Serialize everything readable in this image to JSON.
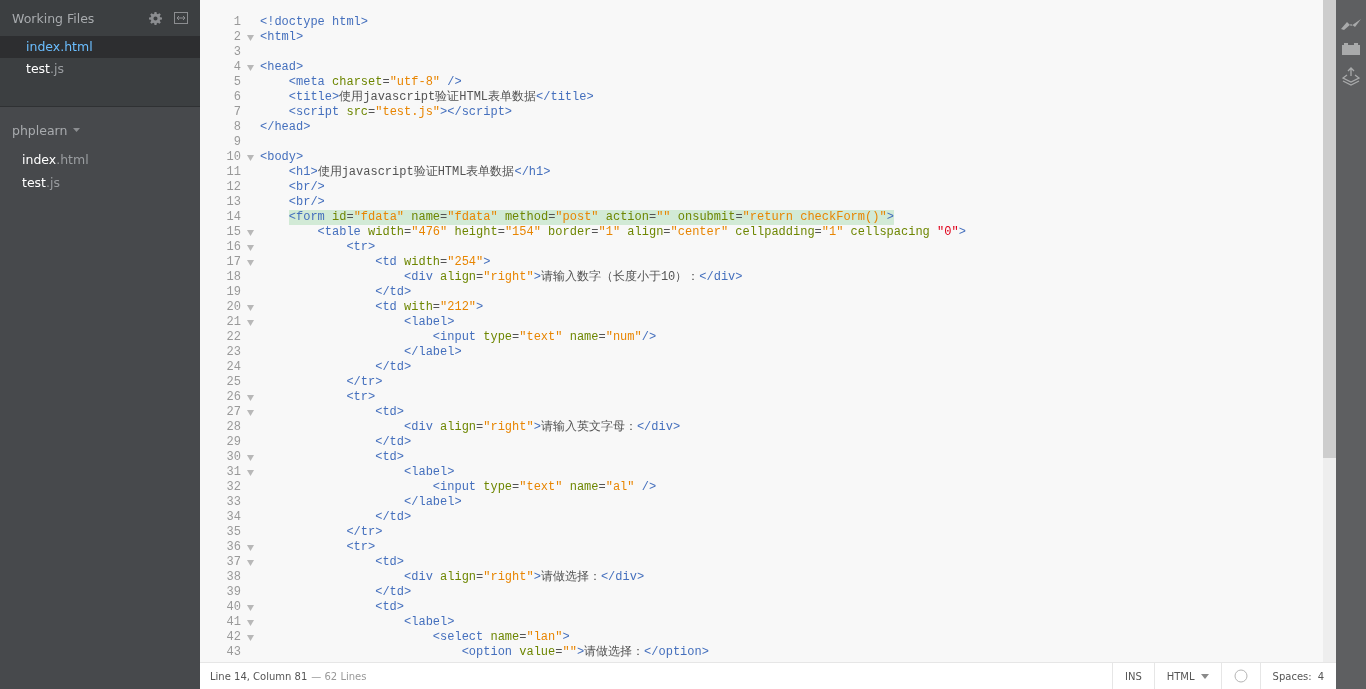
{
  "sidebar": {
    "working_files": {
      "title": "Working Files",
      "items": [
        {
          "name": "index",
          "ext": ".html",
          "selected": true
        },
        {
          "name": "test",
          "ext": ".js",
          "selected": false
        }
      ]
    },
    "project": {
      "title": "phplearn",
      "items": [
        {
          "name": "index",
          "ext": ".html"
        },
        {
          "name": "test",
          "ext": ".js"
        }
      ]
    }
  },
  "editor": {
    "lines": [
      {
        "number": "1",
        "foldable": false,
        "highlighted": false,
        "tokens": [
          {
            "kind": "tag",
            "text": "<!doctype html>"
          }
        ]
      },
      {
        "number": "2",
        "foldable": true,
        "highlighted": false,
        "tokens": [
          {
            "kind": "tag",
            "text": "<html>"
          }
        ]
      },
      {
        "number": "3",
        "foldable": false
      },
      {
        "number": "4",
        "foldable": true,
        "highlighted": false,
        "tokens": [
          {
            "kind": "tag",
            "text": "<head>"
          }
        ]
      },
      {
        "number": "5",
        "foldable": false,
        "highlighted": false,
        "tokens": [
          {
            "kind": "tag",
            "text": "    <meta"
          },
          {
            "kind": "attr",
            "text": " charset"
          },
          {
            "kind": "txt",
            "text": "="
          },
          {
            "kind": "str",
            "text": "\"utf-8\""
          },
          {
            "kind": "tag",
            "text": " />"
          }
        ]
      },
      {
        "number": "6",
        "foldable": false,
        "highlighted": false,
        "tokens": [
          {
            "kind": "tag",
            "text": "    <title>"
          },
          {
            "kind": "txt",
            "text": "使用javascript验证HTML表单数据"
          },
          {
            "kind": "tag",
            "text": "</title>"
          }
        ]
      },
      {
        "number": "7",
        "foldable": false,
        "highlighted": false,
        "tokens": [
          {
            "kind": "tag",
            "text": "    <script"
          },
          {
            "kind": "attr",
            "text": " src"
          },
          {
            "kind": "txt",
            "text": "="
          },
          {
            "kind": "str",
            "text": "\"test.js\""
          },
          {
            "kind": "tag",
            "text": "></script>"
          }
        ]
      },
      {
        "number": "8",
        "foldable": false,
        "highlighted": false,
        "tokens": [
          {
            "kind": "tag",
            "text": "</head>"
          }
        ]
      },
      {
        "number": "9",
        "foldable": false
      },
      {
        "number": "10",
        "foldable": true,
        "highlighted": false,
        "tokens": [
          {
            "kind": "tag",
            "text": "<body>"
          }
        ]
      },
      {
        "number": "11",
        "foldable": false,
        "highlighted": false,
        "tokens": [
          {
            "kind": "tag",
            "text": "    <h1>"
          },
          {
            "kind": "txt",
            "text": "使用javascript验证HTML表单数据"
          },
          {
            "kind": "tag",
            "text": "</h1>"
          }
        ]
      },
      {
        "number": "12",
        "foldable": false,
        "highlighted": false,
        "tokens": [
          {
            "kind": "tag",
            "text": "    <br/>"
          }
        ]
      },
      {
        "number": "13",
        "foldable": false,
        "highlighted": false,
        "tokens": [
          {
            "kind": "tag",
            "text": "    <br/>"
          }
        ]
      },
      {
        "number": "14",
        "foldable": false,
        "highlighted": true,
        "tokens": [
          {
            "kind": "tag",
            "text": "    <form"
          },
          {
            "kind": "attr",
            "text": " id"
          },
          {
            "kind": "txt",
            "text": "="
          },
          {
            "kind": "str",
            "text": "\"fdata\""
          },
          {
            "kind": "attr",
            "text": " name"
          },
          {
            "kind": "txt",
            "text": "="
          },
          {
            "kind": "str",
            "text": "\"fdata\""
          },
          {
            "kind": "attr",
            "text": " method"
          },
          {
            "kind": "txt",
            "text": "="
          },
          {
            "kind": "str",
            "text": "\"post\""
          },
          {
            "kind": "attr",
            "text": " action"
          },
          {
            "kind": "txt",
            "text": "="
          },
          {
            "kind": "str",
            "text": "\"\""
          },
          {
            "kind": "attr",
            "text": " onsubmit"
          },
          {
            "kind": "txt",
            "text": "="
          },
          {
            "kind": "str",
            "text": "\"return checkForm()\""
          },
          {
            "kind": "tag",
            "text": ">"
          }
        ]
      },
      {
        "number": "15",
        "foldable": true,
        "highlighted": false,
        "tokens": [
          {
            "kind": "tag",
            "text": "        <table"
          },
          {
            "kind": "attr",
            "text": " width"
          },
          {
            "kind": "txt",
            "text": "="
          },
          {
            "kind": "str",
            "text": "\"476\""
          },
          {
            "kind": "attr",
            "text": " height"
          },
          {
            "kind": "txt",
            "text": "="
          },
          {
            "kind": "str",
            "text": "\"154\""
          },
          {
            "kind": "attr",
            "text": " border"
          },
          {
            "kind": "txt",
            "text": "="
          },
          {
            "kind": "str",
            "text": "\"1\""
          },
          {
            "kind": "attr",
            "text": " align"
          },
          {
            "kind": "txt",
            "text": "="
          },
          {
            "kind": "str",
            "text": "\"center\""
          },
          {
            "kind": "attr",
            "text": " cellpadding"
          },
          {
            "kind": "txt",
            "text": "="
          },
          {
            "kind": "str",
            "text": "\"1\""
          },
          {
            "kind": "attr",
            "text": " cellspacing "
          },
          {
            "kind": "err",
            "text": "\"0\""
          },
          {
            "kind": "tag",
            "text": ">"
          }
        ]
      },
      {
        "number": "16",
        "foldable": true,
        "highlighted": false,
        "tokens": [
          {
            "kind": "tag",
            "text": "            <tr>"
          }
        ]
      },
      {
        "number": "17",
        "foldable": true,
        "highlighted": false,
        "tokens": [
          {
            "kind": "tag",
            "text": "                <td"
          },
          {
            "kind": "attr",
            "text": " width"
          },
          {
            "kind": "txt",
            "text": "="
          },
          {
            "kind": "str",
            "text": "\"254\""
          },
          {
            "kind": "tag",
            "text": ">"
          }
        ]
      },
      {
        "number": "18",
        "foldable": false,
        "highlighted": false,
        "tokens": [
          {
            "kind": "tag",
            "text": "                    <div"
          },
          {
            "kind": "attr",
            "text": " align"
          },
          {
            "kind": "txt",
            "text": "="
          },
          {
            "kind": "str",
            "text": "\"right\""
          },
          {
            "kind": "tag",
            "text": ">"
          },
          {
            "kind": "txt",
            "text": "请输入数字（长度小于10）："
          },
          {
            "kind": "tag",
            "text": "</div>"
          }
        ]
      },
      {
        "number": "19",
        "foldable": false,
        "highlighted": false,
        "tokens": [
          {
            "kind": "tag",
            "text": "                </td>"
          }
        ]
      },
      {
        "number": "20",
        "foldable": true,
        "highlighted": false,
        "tokens": [
          {
            "kind": "tag",
            "text": "                <td"
          },
          {
            "kind": "attr",
            "text": " with"
          },
          {
            "kind": "txt",
            "text": "="
          },
          {
            "kind": "str",
            "text": "\"212\""
          },
          {
            "kind": "tag",
            "text": ">"
          }
        ]
      },
      {
        "number": "21",
        "foldable": true,
        "highlighted": false,
        "tokens": [
          {
            "kind": "tag",
            "text": "                    <label>"
          }
        ]
      },
      {
        "number": "22",
        "foldable": false,
        "highlighted": false,
        "tokens": [
          {
            "kind": "tag",
            "text": "                        <input"
          },
          {
            "kind": "attr",
            "text": " type"
          },
          {
            "kind": "txt",
            "text": "="
          },
          {
            "kind": "str",
            "text": "\"text\""
          },
          {
            "kind": "attr",
            "text": " name"
          },
          {
            "kind": "txt",
            "text": "="
          },
          {
            "kind": "str",
            "text": "\"num\""
          },
          {
            "kind": "tag",
            "text": "/>"
          }
        ]
      },
      {
        "number": "23",
        "foldable": false,
        "highlighted": false,
        "tokens": [
          {
            "kind": "tag",
            "text": "                    </label>"
          }
        ]
      },
      {
        "number": "24",
        "foldable": false,
        "highlighted": false,
        "tokens": [
          {
            "kind": "tag",
            "text": "                </td>"
          }
        ]
      },
      {
        "number": "25",
        "foldable": false,
        "highlighted": false,
        "tokens": [
          {
            "kind": "tag",
            "text": "            </tr>"
          }
        ]
      },
      {
        "number": "26",
        "foldable": true,
        "highlighted": false,
        "tokens": [
          {
            "kind": "tag",
            "text": "            <tr>"
          }
        ]
      },
      {
        "number": "27",
        "foldable": true,
        "highlighted": false,
        "tokens": [
          {
            "kind": "tag",
            "text": "                <td>"
          }
        ]
      },
      {
        "number": "28",
        "foldable": false,
        "highlighted": false,
        "tokens": [
          {
            "kind": "tag",
            "text": "                    <div"
          },
          {
            "kind": "attr",
            "text": " align"
          },
          {
            "kind": "txt",
            "text": "="
          },
          {
            "kind": "str",
            "text": "\"right\""
          },
          {
            "kind": "tag",
            "text": ">"
          },
          {
            "kind": "txt",
            "text": "请输入英文字母："
          },
          {
            "kind": "tag",
            "text": "</div>"
          }
        ]
      },
      {
        "number": "29",
        "foldable": false,
        "highlighted": false,
        "tokens": [
          {
            "kind": "tag",
            "text": "                </td>"
          }
        ]
      },
      {
        "number": "30",
        "foldable": true,
        "highlighted": false,
        "tokens": [
          {
            "kind": "tag",
            "text": "                <td>"
          }
        ]
      },
      {
        "number": "31",
        "foldable": true,
        "highlighted": false,
        "tokens": [
          {
            "kind": "tag",
            "text": "                    <label>"
          }
        ]
      },
      {
        "number": "32",
        "foldable": false,
        "highlighted": false,
        "tokens": [
          {
            "kind": "tag",
            "text": "                        <input"
          },
          {
            "kind": "attr",
            "text": " type"
          },
          {
            "kind": "txt",
            "text": "="
          },
          {
            "kind": "str",
            "text": "\"text\""
          },
          {
            "kind": "attr",
            "text": " name"
          },
          {
            "kind": "txt",
            "text": "="
          },
          {
            "kind": "str",
            "text": "\"al\""
          },
          {
            "kind": "tag",
            "text": " />"
          }
        ]
      },
      {
        "number": "33",
        "foldable": false,
        "highlighted": false,
        "tokens": [
          {
            "kind": "tag",
            "text": "                    </label>"
          }
        ]
      },
      {
        "number": "34",
        "foldable": false,
        "highlighted": false,
        "tokens": [
          {
            "kind": "tag",
            "text": "                </td>"
          }
        ]
      },
      {
        "number": "35",
        "foldable": false,
        "highlighted": false,
        "tokens": [
          {
            "kind": "tag",
            "text": "            </tr>"
          }
        ]
      },
      {
        "number": "36",
        "foldable": true,
        "highlighted": false,
        "tokens": [
          {
            "kind": "tag",
            "text": "            <tr>"
          }
        ]
      },
      {
        "number": "37",
        "foldable": true,
        "highlighted": false,
        "tokens": [
          {
            "kind": "tag",
            "text": "                <td>"
          }
        ]
      },
      {
        "number": "38",
        "foldable": false,
        "highlighted": false,
        "tokens": [
          {
            "kind": "tag",
            "text": "                    <div"
          },
          {
            "kind": "attr",
            "text": " align"
          },
          {
            "kind": "txt",
            "text": "="
          },
          {
            "kind": "str",
            "text": "\"right\""
          },
          {
            "kind": "tag",
            "text": ">"
          },
          {
            "kind": "txt",
            "text": "请做选择："
          },
          {
            "kind": "tag",
            "text": "</div>"
          }
        ]
      },
      {
        "number": "39",
        "foldable": false,
        "highlighted": false,
        "tokens": [
          {
            "kind": "tag",
            "text": "                </td>"
          }
        ]
      },
      {
        "number": "40",
        "foldable": true,
        "highlighted": false,
        "tokens": [
          {
            "kind": "tag",
            "text": "                <td>"
          }
        ]
      },
      {
        "number": "41",
        "foldable": true,
        "highlighted": false,
        "tokens": [
          {
            "kind": "tag",
            "text": "                    <label>"
          }
        ]
      },
      {
        "number": "42",
        "foldable": true,
        "highlighted": false,
        "tokens": [
          {
            "kind": "tag",
            "text": "                        <select"
          },
          {
            "kind": "attr",
            "text": " name"
          },
          {
            "kind": "txt",
            "text": "="
          },
          {
            "kind": "str",
            "text": "\"lan\""
          },
          {
            "kind": "tag",
            "text": ">"
          }
        ]
      },
      {
        "number": "43",
        "foldable": false,
        "highlighted": false,
        "tokens": [
          {
            "kind": "tag",
            "text": "                            <option"
          },
          {
            "kind": "attr",
            "text": " value"
          },
          {
            "kind": "txt",
            "text": "="
          },
          {
            "kind": "str",
            "text": "\"\""
          },
          {
            "kind": "tag",
            "text": ">"
          },
          {
            "kind": "txt",
            "text": "请做选择："
          },
          {
            "kind": "tag",
            "text": "</option>"
          }
        ]
      }
    ]
  },
  "status_bar": {
    "position": "Line 14, Column 81",
    "line_count": "— 62 Lines",
    "mode": "INS",
    "language": "HTML",
    "indent_label": "Spaces:",
    "indent_size": "4"
  }
}
